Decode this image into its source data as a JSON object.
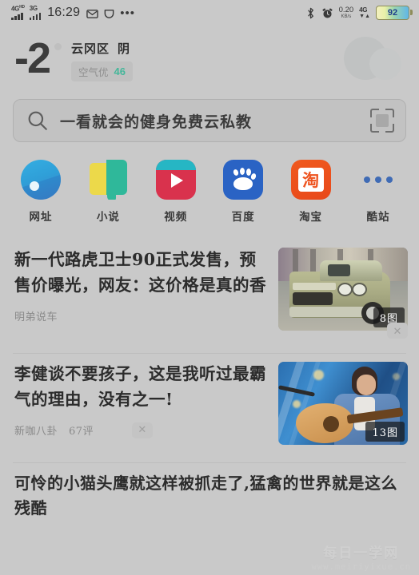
{
  "statusbar": {
    "network_1": "4G",
    "network_1_sup": "HD",
    "network_2": "3G",
    "time": "16:29",
    "mail_icon": "envelope-icon",
    "vpn_icon": "shield-icon",
    "overflow_icon": "more-horizontal-icon",
    "bluetooth_icon": "bluetooth-icon",
    "alarm_icon": "alarm-clock-icon",
    "net_speed_value": "0.20",
    "net_speed_unit": "KB/s",
    "network_3": "4G",
    "battery_percent": "92"
  },
  "weather": {
    "temperature": "-2",
    "location": "云冈区",
    "condition": "阴",
    "air_quality_label": "空气优",
    "air_quality_value": "46",
    "air_quality_color": "#45b79a",
    "condition_icon": "overcast-cloud-icon"
  },
  "search": {
    "icon": "search-icon",
    "query": "一看就会的健身免费云私教",
    "scan_icon": "qr-scan-icon"
  },
  "apps": [
    {
      "label": "网址",
      "icon": "website-icon"
    },
    {
      "label": "小说",
      "icon": "novel-book-icon"
    },
    {
      "label": "视频",
      "icon": "video-play-icon"
    },
    {
      "label": "百度",
      "icon": "baidu-paw-icon"
    },
    {
      "label": "淘宝",
      "icon": "taobao-icon",
      "glyph": "淘"
    },
    {
      "label": "酷站",
      "icon": "more-dots-icon"
    }
  ],
  "feed": [
    {
      "title": "新一代路虎卫士90正式发售，预售价曝光，网友：这价格是真的香",
      "source": "明弟说车",
      "comments": "",
      "image_badge": "8图",
      "thumbnail": "land-rover-defender-photo",
      "close_icon": "close-icon"
    },
    {
      "title": "李健谈不要孩子，这是我听过最霸气的理由，没有之一!",
      "source": "新咖八卦",
      "comments": "67评",
      "image_badge": "13图",
      "thumbnail": "singer-with-guitar-photo",
      "close_icon": "close-icon"
    },
    {
      "title": "可怜的小猫头鹰就这样被抓走了,猛禽的世界就是这么残酷",
      "source": "",
      "comments": "",
      "image_badge": "",
      "thumbnail": "",
      "close_icon": ""
    }
  ],
  "watermark": {
    "name": "每日一学网",
    "url": "www.meiriyixue.cn"
  }
}
